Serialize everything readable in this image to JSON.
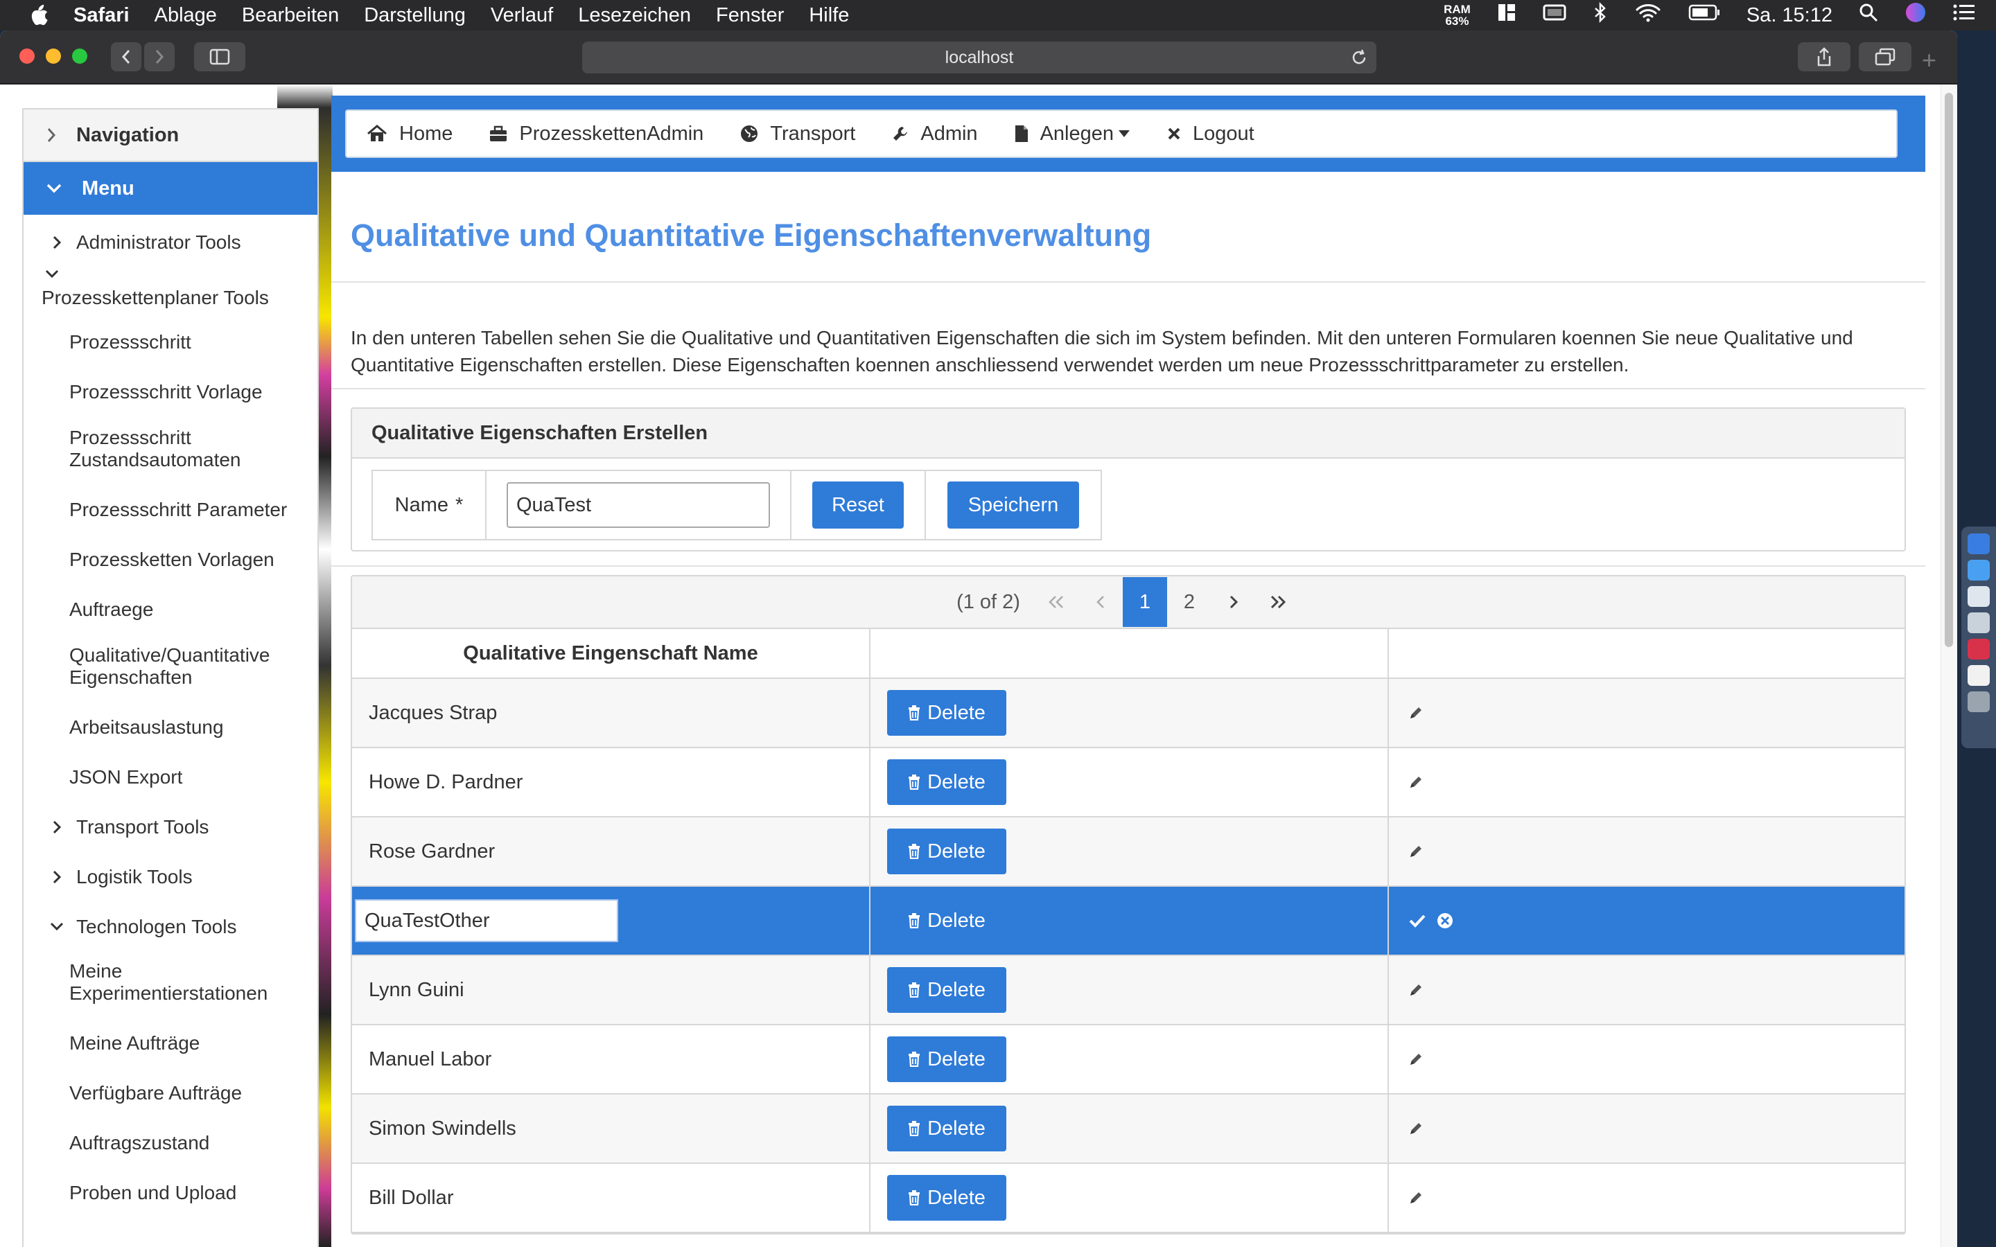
{
  "menubar": {
    "app": "Safari",
    "items": [
      "Ablage",
      "Bearbeiten",
      "Darstellung",
      "Verlauf",
      "Lesezeichen",
      "Fenster",
      "Hilfe"
    ],
    "ram_label": "RAM",
    "ram_value": "63%",
    "clock": "Sa. 15:12"
  },
  "browser": {
    "url": "localhost"
  },
  "sidebar": {
    "navigation": "Navigation",
    "menu": "Menu",
    "admin_tools": "Administrator Tools",
    "planer_tools": "Prozesskettenplaner Tools",
    "planer_items": [
      "Prozessschritt",
      "Prozessschritt Vorlage",
      "Prozessschritt Zustandsautomaten",
      "Prozessschritt Parameter",
      "Prozessketten Vorlagen",
      "Auftraege",
      "Qualitative/Quantitative Eigenschaften",
      "Arbeitsauslastung",
      "JSON Export"
    ],
    "transport_tools": "Transport Tools",
    "logistik_tools": "Logistik Tools",
    "technologen_tools": "Technologen Tools",
    "technologen_items": [
      "Meine Experimentierstationen",
      "Meine Aufträge",
      "Verfügbare Aufträge",
      "Auftragszustand",
      "Proben und Upload"
    ]
  },
  "topnav": {
    "home": "Home",
    "pkadmin": "ProzesskettenAdmin",
    "transport": "Transport",
    "admin": "Admin",
    "anlegen": "Anlegen",
    "logout": "Logout"
  },
  "page": {
    "title": "Qualitative und Quantitative Eigenschaftenverwaltung",
    "description": "In den unteren Tabellen sehen Sie die Qualitative und Quantitativen Eigenschaften die sich im System befinden. Mit den unteren Formularen koennen Sie neue Qualitative und Quantitative Eigenschaften erstellen. Diese Eigenschaften koennen anschliessend verwendet werden um neue Prozessschrittparameter zu erstellen."
  },
  "form": {
    "header": "Qualitative Eigenschaften Erstellen",
    "name_label": "Name",
    "required_mark": "*",
    "name_value": "QuaTest",
    "reset": "Reset",
    "save": "Speichern"
  },
  "table": {
    "pager_report": "(1 of 2)",
    "pages": [
      "1",
      "2"
    ],
    "current_page": "1",
    "header_name": "Qualitative Eingenschaft Name",
    "delete_label": "Delete",
    "rows": [
      {
        "name": "Jacques Strap"
      },
      {
        "name": "Howe D. Pardner"
      },
      {
        "name": "Rose Gardner"
      },
      {
        "name": "QuaTestOther",
        "editing": true
      },
      {
        "name": "Lynn Guini"
      },
      {
        "name": "Manuel Labor"
      },
      {
        "name": "Simon Swindells"
      },
      {
        "name": "Bill Dollar"
      }
    ]
  },
  "colors": {
    "accent": "#2f7bd8",
    "title": "#4f8fe4"
  }
}
